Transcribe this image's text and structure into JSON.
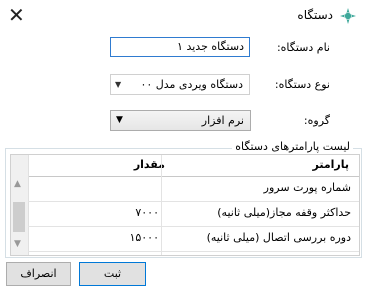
{
  "window": {
    "title": "دستگاه",
    "close_label": "✕"
  },
  "form": {
    "name_label": "نام دستگاه:",
    "name_value": "دستگاه جدید ۱",
    "type_label": "نوع دستگاه:",
    "type_value": "دستگاه ویردی مدل ۰۰",
    "group_label": "گروه:",
    "group_value": "نرم افزار"
  },
  "parameters": {
    "group_title": "لیست پارامترهای دستگاه",
    "columns": {
      "param": "پارامتر",
      "value": "مقدار"
    },
    "rows": [
      {
        "param": "شماره پورت سرور",
        "value": ""
      },
      {
        "param": "حداکثر وقفه مجاز(میلی ثانیه)",
        "value": "۷۰۰۰"
      },
      {
        "param": "دوره بررسی اتصال (میلی ثانیه)",
        "value": "۱۵۰۰۰"
      }
    ]
  },
  "buttons": {
    "cancel": "انصراف",
    "save": "ثبت"
  },
  "colors": {
    "focus_border": "#2f7bd0",
    "app_icon": "#3ea89a"
  }
}
